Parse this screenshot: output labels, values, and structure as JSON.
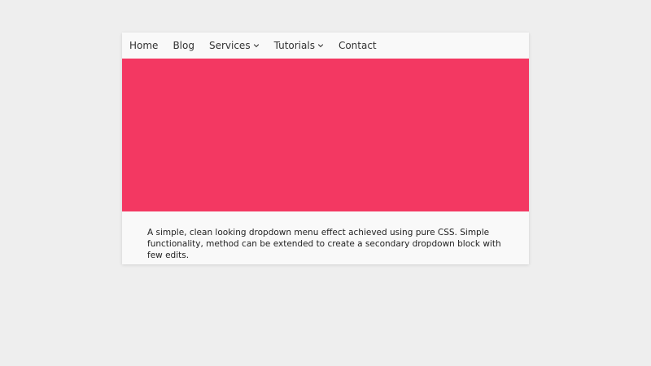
{
  "nav": {
    "items": [
      {
        "label": "Home",
        "has_dropdown": false
      },
      {
        "label": "Blog",
        "has_dropdown": false
      },
      {
        "label": "Services",
        "has_dropdown": true
      },
      {
        "label": "Tutorials",
        "has_dropdown": true
      },
      {
        "label": "Contact",
        "has_dropdown": false
      }
    ]
  },
  "hero": {
    "color": "#f33862"
  },
  "description": "A simple, clean looking dropdown menu effect achieved using pure CSS. Simple functionality, method can be extended to create a secondary dropdown block with few edits.",
  "colors": {
    "background": "#eeeeee",
    "card": "#f9f9f9",
    "accent": "#f33862",
    "text": "#333333"
  }
}
